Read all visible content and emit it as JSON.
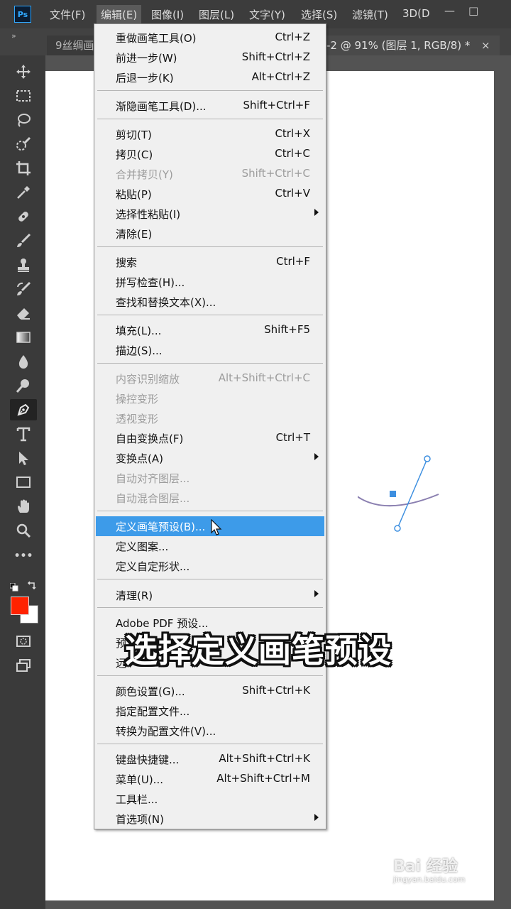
{
  "app": {
    "logo": "Ps",
    "menus": [
      "文件(F)",
      "编辑(E)",
      "图像(I)",
      "图层(L)",
      "文字(Y)",
      "选择(S)",
      "滤镜(T)",
      "3D(D"
    ],
    "window_controls": [
      "—",
      "□"
    ]
  },
  "tabs": {
    "collapse": "»",
    "left_tab": "9丝绸画",
    "active_tab": "-2 @ 91% (图层 1, RGB/8) *",
    "close": "×"
  },
  "toolbar": {
    "tools": [
      "move-tool",
      "marquee-tool",
      "lasso-tool",
      "quick-select-tool",
      "crop-tool",
      "eyedropper-tool",
      "healing-tool",
      "brush-tool",
      "stamp-tool",
      "history-brush-tool",
      "eraser-tool",
      "gradient-tool",
      "blur-tool",
      "dodge-tool",
      "pen-tool",
      "type-tool",
      "path-select-tool",
      "rectangle-tool",
      "hand-tool",
      "zoom-tool",
      "more-tools"
    ],
    "selected_tool": "pen-tool",
    "more_tools": "•••",
    "foreground_color": "#ff2200",
    "background_color": "#ffffff"
  },
  "edit_menu": {
    "items": [
      {
        "label": "重做画笔工具(O)",
        "shortcut": "Ctrl+Z"
      },
      {
        "label": "前进一步(W)",
        "shortcut": "Shift+Ctrl+Z"
      },
      {
        "label": "后退一步(K)",
        "shortcut": "Alt+Ctrl+Z"
      },
      {
        "label": "渐隐画笔工具(D)...",
        "shortcut": "Shift+Ctrl+F"
      },
      {
        "label": "剪切(T)",
        "shortcut": "Ctrl+X"
      },
      {
        "label": "拷贝(C)",
        "shortcut": "Ctrl+C"
      },
      {
        "label": "合并拷贝(Y)",
        "shortcut": "Shift+Ctrl+C",
        "disabled": true
      },
      {
        "label": "粘贴(P)",
        "shortcut": "Ctrl+V"
      },
      {
        "label": "选择性粘贴(I)",
        "shortcut": "",
        "submenu": true
      },
      {
        "label": "清除(E)",
        "shortcut": ""
      },
      {
        "label": "搜索",
        "shortcut": "Ctrl+F"
      },
      {
        "label": "拼写检查(H)...",
        "shortcut": ""
      },
      {
        "label": "查找和替换文本(X)...",
        "shortcut": ""
      },
      {
        "label": "填充(L)...",
        "shortcut": "Shift+F5"
      },
      {
        "label": "描边(S)...",
        "shortcut": ""
      },
      {
        "label": "内容识别缩放",
        "shortcut": "Alt+Shift+Ctrl+C",
        "disabled": true
      },
      {
        "label": "操控变形",
        "shortcut": "",
        "disabled": true
      },
      {
        "label": "透视变形",
        "shortcut": "",
        "disabled": true
      },
      {
        "label": "自由变换点(F)",
        "shortcut": "Ctrl+T"
      },
      {
        "label": "变换点(A)",
        "shortcut": "",
        "submenu": true
      },
      {
        "label": "自动对齐图层...",
        "shortcut": "",
        "disabled": true
      },
      {
        "label": "自动混合图层...",
        "shortcut": "",
        "disabled": true
      },
      {
        "label": "定义画笔预设(B)...",
        "shortcut": "",
        "highlighted": true
      },
      {
        "label": "定义图案...",
        "shortcut": ""
      },
      {
        "label": "定义自定形状...",
        "shortcut": ""
      },
      {
        "label": "清理(R)",
        "shortcut": "",
        "submenu": true
      },
      {
        "label": "Adobe PDF 预设...",
        "shortcut": ""
      },
      {
        "label": "预",
        "shortcut": ""
      },
      {
        "label": "远",
        "shortcut": ""
      },
      {
        "label": "颜色设置(G)...",
        "shortcut": "Shift+Ctrl+K"
      },
      {
        "label": "指定配置文件...",
        "shortcut": ""
      },
      {
        "label": "转换为配置文件(V)...",
        "shortcut": ""
      },
      {
        "label": "键盘快捷键...",
        "shortcut": "Alt+Shift+Ctrl+K"
      },
      {
        "label": "菜单(U)...",
        "shortcut": "Alt+Shift+Ctrl+M"
      },
      {
        "label": "工具栏...",
        "shortcut": ""
      },
      {
        "label": "首选项(N)",
        "shortcut": "",
        "submenu": true
      }
    ]
  },
  "caption": "选择定义画笔预设",
  "watermark": {
    "main": "Bai 经验",
    "sub": "jingyan.baidu.com"
  }
}
